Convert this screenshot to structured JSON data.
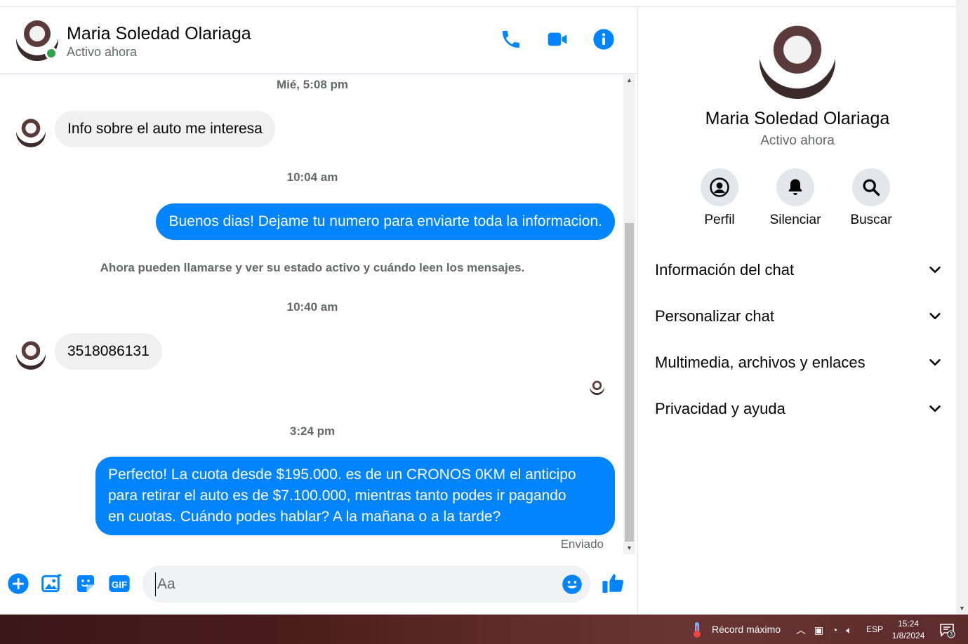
{
  "header": {
    "name": "Maria Soledad Olariaga",
    "status": "Activo ahora"
  },
  "messages": {
    "ts1": "Mié, 5:08 pm",
    "m1": "Info sobre el auto me interesa",
    "ts2": "10:04 am",
    "m2": "Buenos dias! Dejame tu numero para enviarte toda la informacion.",
    "system": "Ahora pueden llamarse y ver su estado activo y cuándo leen los mensajes.",
    "ts3": "10:40 am",
    "m3": "3518086131",
    "ts4": "3:24 pm",
    "m4_line1": "Perfecto! La cuota desde $195.000. es de un CRONOS 0KM el anticipo",
    "m4_line2": "para retirar el auto es de $7.100.000, mientras tanto podes ir pagando",
    "m4_line3": "en cuotas. Cuándo podes hablar? A la mañana o a la tarde?",
    "sent": "Enviado"
  },
  "composer": {
    "placeholder": "Aa"
  },
  "side": {
    "name": "Maria Soledad Olariaga",
    "status": "Activo ahora",
    "actions": [
      "Perfil",
      "Silenciar",
      "Buscar"
    ],
    "sections": [
      "Información del chat",
      "Personalizar chat",
      "Multimedia, archivos y enlaces",
      "Privacidad y ayuda"
    ]
  },
  "taskbar": {
    "weather": "Récord máximo",
    "lang": "ESP",
    "time": "15:24",
    "date": "1/8/2024",
    "notif_count": "3"
  },
  "colors": {
    "accent": "#0084ff",
    "online": "#31a24c",
    "bubble_in": "#f0f0f0"
  }
}
